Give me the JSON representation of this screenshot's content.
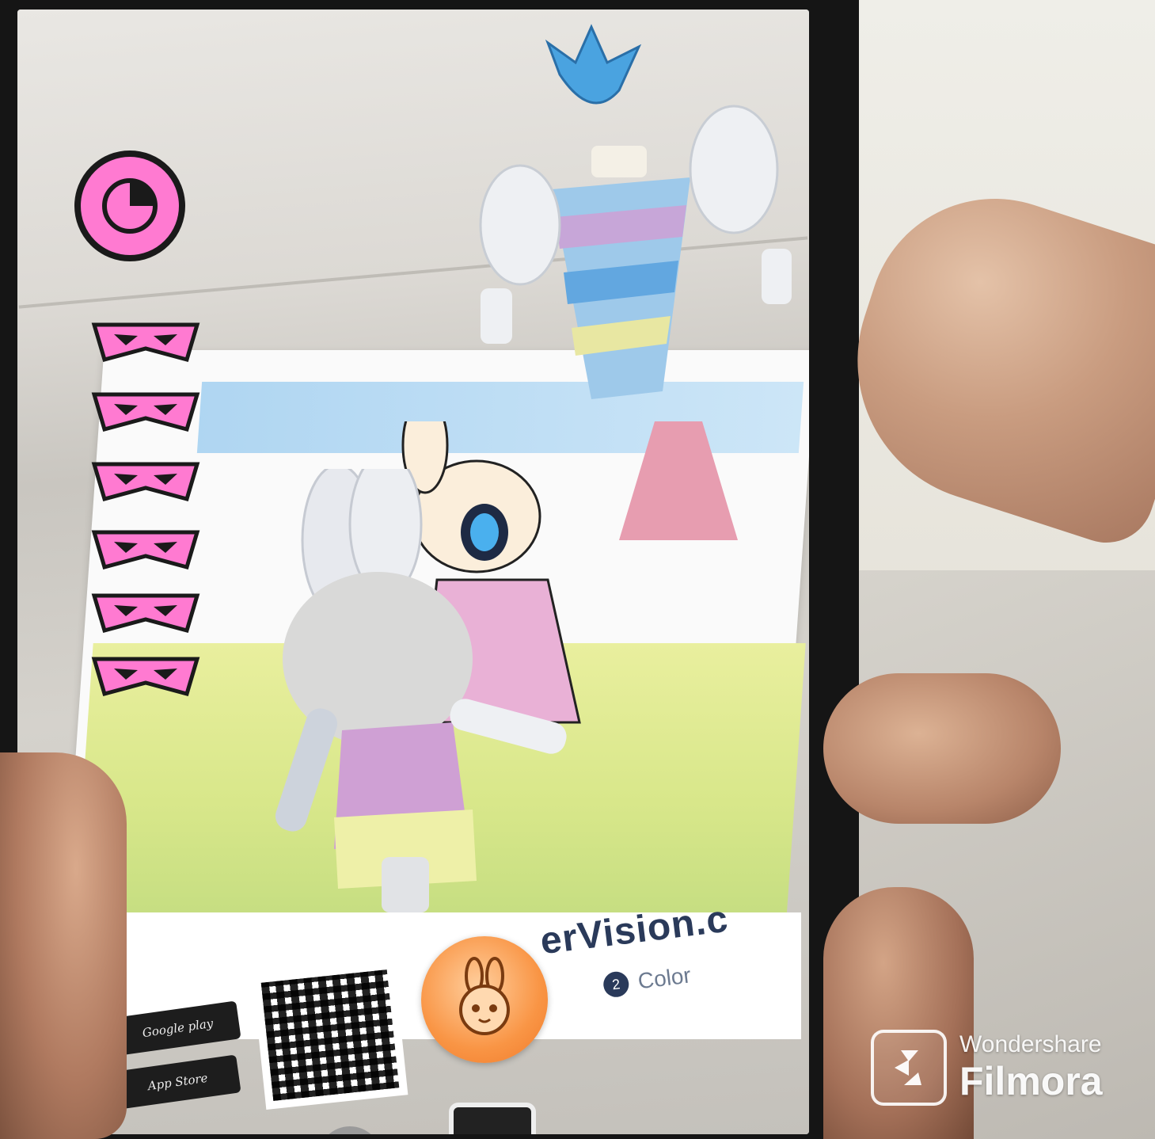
{
  "hud": {
    "lives_count": 6,
    "timer_icon": "timer-icon",
    "accent_color": "#ff7ad1"
  },
  "printed_sheet": {
    "url_text": "erVision.c",
    "step_number": "2",
    "step_label": "Color",
    "badge_1": "Google play",
    "badge_2": "App Store"
  },
  "controls": {
    "character_button_icon": "bunny-face-icon",
    "shutter_icon": "camera-icon"
  },
  "watermark": {
    "brand": "Wondershare",
    "product": "Filmora"
  }
}
